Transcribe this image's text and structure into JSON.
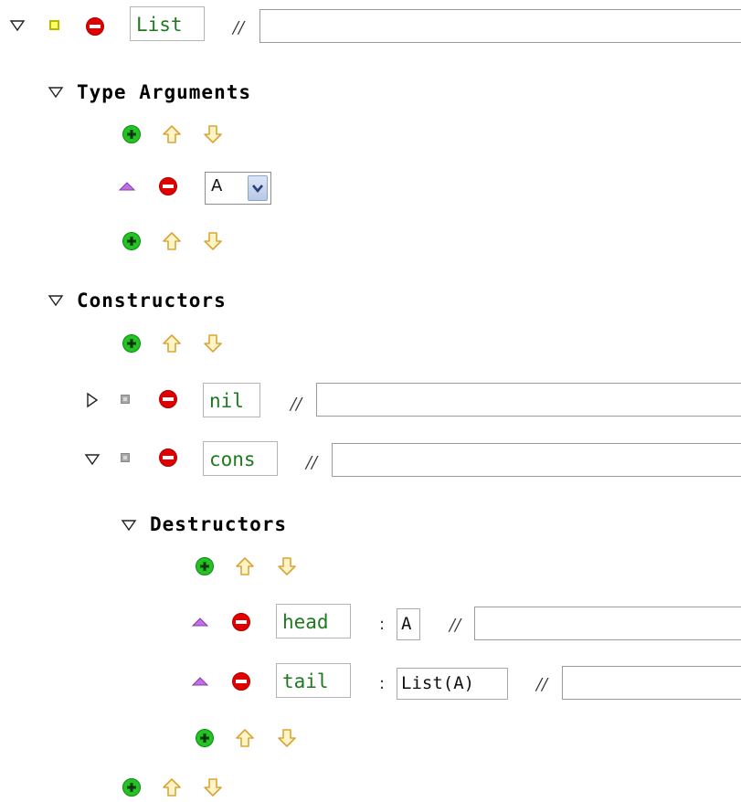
{
  "root": {
    "name": "List",
    "comment_mark": "//",
    "comment_value": ""
  },
  "type_arguments": {
    "title": "Type Arguments",
    "items": [
      {
        "selected": "A"
      }
    ]
  },
  "constructors": {
    "title": "Constructors",
    "items": [
      {
        "name": "nil",
        "comment_mark": "//",
        "comment_value": "",
        "expanded": false
      },
      {
        "name": "cons",
        "comment_mark": "//",
        "comment_value": "",
        "expanded": true
      }
    ]
  },
  "destructors": {
    "title": "Destructors",
    "items": [
      {
        "name": "head",
        "colon": ":",
        "type": "A",
        "comment_mark": "//",
        "comment_value": ""
      },
      {
        "name": "tail",
        "colon": ":",
        "type": "List(A)",
        "comment_mark": "//",
        "comment_value": ""
      }
    ]
  },
  "icons": {
    "expand": "triangle-down-icon",
    "collapse": "triangle-right-icon",
    "remove": "remove-icon",
    "add": "add-icon",
    "move_up": "arrow-up-icon",
    "move_down": "arrow-down-icon",
    "drag": "drag-up-icon"
  },
  "colors": {
    "name_text": "#1f7a1f",
    "remove": "#e00000",
    "add": "#22c322",
    "arrows": "#e8b84c",
    "drag": "#a050c8"
  }
}
